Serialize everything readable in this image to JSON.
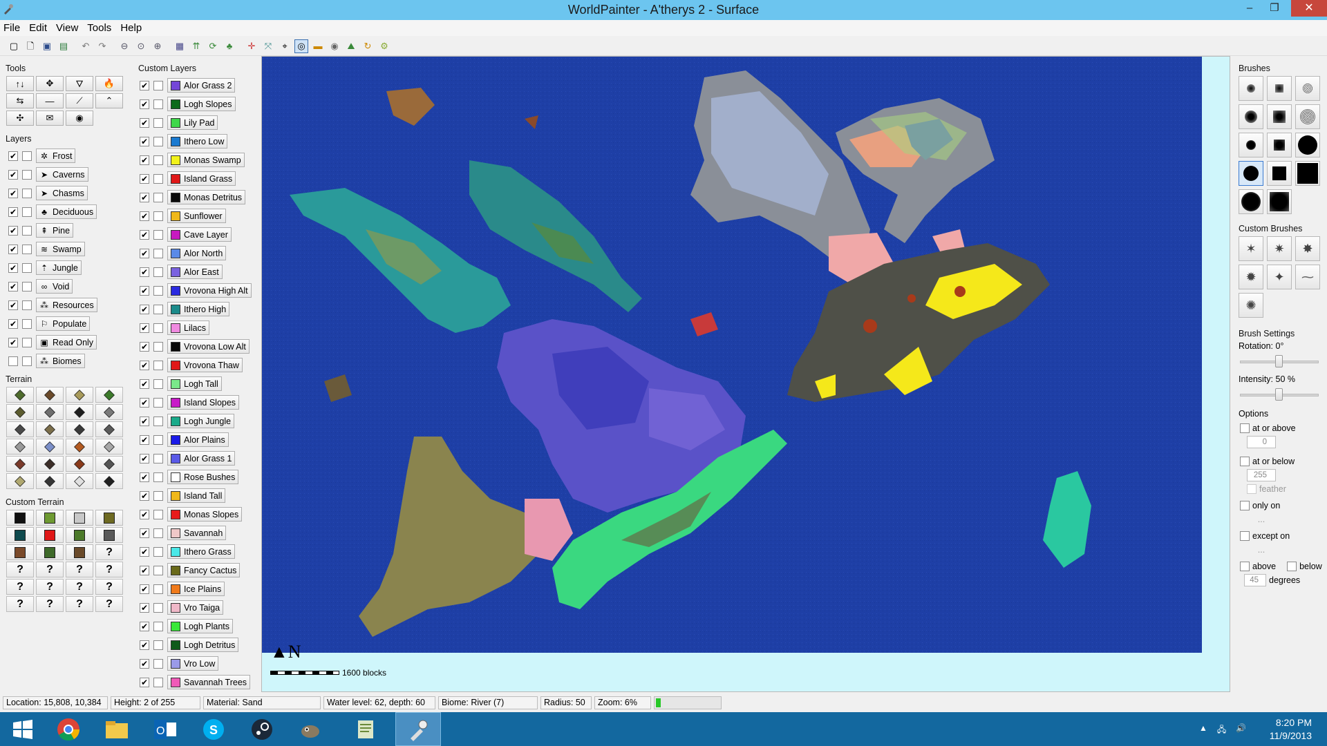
{
  "window": {
    "title": "WorldPainter - A'therys 2 - Surface",
    "minimize": "–",
    "restore": "❐",
    "close": "✕"
  },
  "menu": [
    "File",
    "Edit",
    "View",
    "Tools",
    "Help"
  ],
  "toolbar_icons": [
    "new-world-icon",
    "new-file-icon",
    "save-icon",
    "export-icon",
    "undo-icon",
    "redo-icon",
    "zoom-out-icon",
    "zoom-reset-icon",
    "zoom-in-icon",
    "grid-icon",
    "contours-icon",
    "rotate-icon",
    "layers-icon",
    "move-icon",
    "resize-icon",
    "crosshair-icon",
    "target-icon",
    "image-icon",
    "view-icon",
    "world-icon",
    "refresh-icon",
    "settings-icon"
  ],
  "tools": {
    "title": "Tools",
    "icons": [
      "↑↓",
      "✥",
      "🜄",
      "🔥",
      "⇆",
      "—",
      "⟋",
      "⌃",
      "✣",
      "✉",
      "◉"
    ]
  },
  "layers": {
    "title": "Layers",
    "items": [
      {
        "label": "Frost",
        "icon": "✲",
        "checked": true
      },
      {
        "label": "Caverns",
        "icon": "➤",
        "checked": true
      },
      {
        "label": "Chasms",
        "icon": "➤",
        "checked": true
      },
      {
        "label": "Deciduous",
        "icon": "♣",
        "checked": true
      },
      {
        "label": "Pine",
        "icon": "⇞",
        "checked": true
      },
      {
        "label": "Swamp",
        "icon": "≋",
        "checked": true
      },
      {
        "label": "Jungle",
        "icon": "⇡",
        "checked": true
      },
      {
        "label": "Void",
        "icon": "∞",
        "checked": true
      },
      {
        "label": "Resources",
        "icon": "⁂",
        "checked": true
      },
      {
        "label": "Populate",
        "icon": "⚐",
        "checked": true
      },
      {
        "label": "Read Only",
        "icon": "▣",
        "checked": true
      },
      {
        "label": "Biomes",
        "icon": "⁂",
        "checked": false
      }
    ]
  },
  "terrain": {
    "title": "Terrain",
    "colors": [
      "#4e6b2c",
      "#6b4a2a",
      "#a89a5a",
      "#3c7a2a",
      "#5b5b2e",
      "#6e6e6e",
      "#1e1e1e",
      "#7a7a7a",
      "#4a4a4a",
      "#7b6e4a",
      "#3a3a3a",
      "#5a5a5a",
      "#9a9a9a",
      "#7b8fc8",
      "#b35a20",
      "#a8a8a8",
      "#7a3a2a",
      "#3c2e28",
      "#8a3a1a",
      "#555555",
      "#b0a870",
      "#353535",
      "#e0e0e0",
      "#202020"
    ]
  },
  "custom_terrain": {
    "title": "Custom Terrain",
    "swatches": [
      "#111111",
      "#6e9a32",
      "#c8c8c8",
      "#6e6a22",
      "#0f4a4e",
      "#e01818",
      "#4c7a2a",
      "#5a5a5a",
      "#7a4a2a",
      "#3f6a2a",
      "#6a4a2a",
      "?",
      "?",
      "?",
      "?",
      "?",
      "?",
      "?",
      "?",
      "?",
      "?",
      "?",
      "?",
      "?"
    ]
  },
  "custom_layers": {
    "title": "Custom Layers",
    "items": [
      {
        "label": "Alor Grass 2",
        "color": "#7446d8"
      },
      {
        "label": "Logh Slopes",
        "color": "#0e6a1a"
      },
      {
        "label": "Lily Pad",
        "color": "#3ed84a"
      },
      {
        "label": "Ithero Low",
        "color": "#1a7ad0"
      },
      {
        "label": "Monas Swamp",
        "color": "#f2f21a"
      },
      {
        "label": "Island Grass",
        "color": "#e01818"
      },
      {
        "label": "Monas Detritus",
        "color": "#0a0a0a"
      },
      {
        "label": "Sunflower",
        "color": "#f0b81a"
      },
      {
        "label": "Cave Layer",
        "color": "#c81ac0"
      },
      {
        "label": "Alor North",
        "color": "#5a8ae8"
      },
      {
        "label": "Alor East",
        "color": "#7a62e0"
      },
      {
        "label": "Vrovona High Alt",
        "color": "#2a2ae0"
      },
      {
        "label": "Ithero High",
        "color": "#1a8a8a"
      },
      {
        "label": "Lilacs",
        "color": "#f08ae0"
      },
      {
        "label": "Vrovona Low Alt",
        "color": "#0a0a0a"
      },
      {
        "label": "Vrovona Thaw",
        "color": "#e01818"
      },
      {
        "label": "Logh Tall",
        "color": "#7ae88a"
      },
      {
        "label": "Island Slopes",
        "color": "#c81ac8"
      },
      {
        "label": "Logh Jungle",
        "color": "#1aaa8a"
      },
      {
        "label": "Alor Plains",
        "color": "#1a1ae8"
      },
      {
        "label": "Alor Grass 1",
        "color": "#5a5ae8"
      },
      {
        "label": "Rose Bushes",
        "color": "#ffffff"
      },
      {
        "label": "Island Tall",
        "color": "#f0b81a"
      },
      {
        "label": "Monas Slopes",
        "color": "#e81a1a"
      },
      {
        "label": "Savannah",
        "color": "#f0c8c8"
      },
      {
        "label": "Ithero Grass",
        "color": "#4ae8e8"
      },
      {
        "label": "Fancy Cactus",
        "color": "#6a6a1a"
      },
      {
        "label": "Ice Plains",
        "color": "#f07a1a"
      },
      {
        "label": "Vro Taiga",
        "color": "#f0b8c8"
      },
      {
        "label": "Logh Plants",
        "color": "#3ae83a"
      },
      {
        "label": "Logh Detritus",
        "color": "#0e5a1a"
      },
      {
        "label": "Vro Low",
        "color": "#9a9ae8"
      },
      {
        "label": "Savannah Trees",
        "color": "#f05ab8"
      }
    ]
  },
  "map": {
    "scale_label": "1600 blocks",
    "compass": "N"
  },
  "brushes": {
    "title": "Brushes",
    "custom_title": "Custom Brushes"
  },
  "brush_settings": {
    "title": "Brush Settings",
    "rotation": "Rotation: 0°",
    "rotation_value": 0.5,
    "intensity": "Intensity: 50 %",
    "intensity_value": 0.5,
    "options_title": "Options",
    "at_or_above": "at or above",
    "at_or_above_value": "0",
    "at_or_below": "at or below",
    "at_or_below_value": "255",
    "feather": "feather",
    "only_on": "only on",
    "only_on_value": "...",
    "except_on": "except on",
    "except_on_value": "...",
    "above": "above",
    "below": "below",
    "degrees_value": "45",
    "degrees": "degrees"
  },
  "status": {
    "location": "Location: 15,808, 10,384",
    "height": "Height: 2 of 255",
    "material": "Material: Sand",
    "water": "Water level: 62, depth: 60",
    "biome": "Biome: River (7)",
    "radius": "Radius: 50",
    "zoom": "Zoom: 6%",
    "progress": 0.08
  },
  "taskbar": {
    "apps": [
      "windows-start-icon",
      "chrome-icon",
      "file-explorer-icon",
      "outlook-icon",
      "skype-icon",
      "steam-icon",
      "gimp-icon",
      "notepad-icon",
      "worldpainter-icon"
    ],
    "time": "8:20 PM",
    "date": "11/9/2013"
  }
}
